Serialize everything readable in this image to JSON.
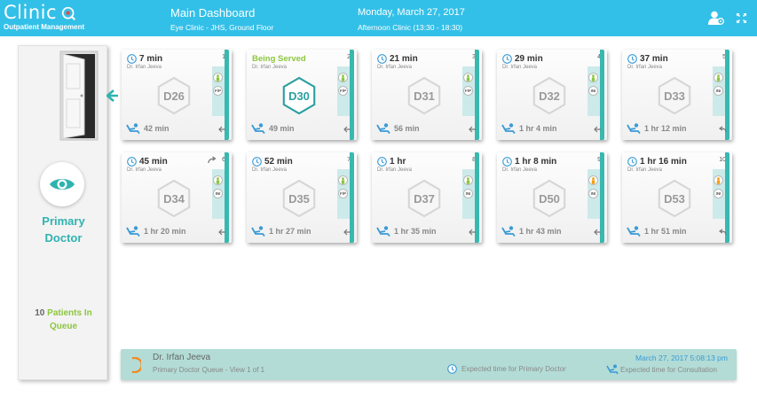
{
  "header": {
    "brand": "Clinic",
    "brand_sub": "Outpatient Management",
    "title": "Main Dashboard",
    "subtitle": "Eye Clinic - JHS, Ground Floor",
    "date": "Monday, March 27, 2017",
    "session": "Afternoon Clinic (13:30 - 18:30)",
    "icons": [
      "user-settings-icon",
      "fullscreen-icon"
    ]
  },
  "panel": {
    "role_line1": "Primary",
    "role_line2": "Doctor",
    "queue_count": "10",
    "queue_label1": "Patients In",
    "queue_label2": "Queue"
  },
  "cards": [
    {
      "time": "7 min",
      "doctor": "Dr. Irfan Jeeva",
      "num": "1",
      "code": "D26",
      "wait": "42 min",
      "served": false,
      "status": "F/P",
      "status_color": "#8cc63f",
      "ret": false,
      "fwd": false
    },
    {
      "time": "Being Served",
      "doctor": "Dr. Irfan Jeeva",
      "num": "2",
      "code": "D30",
      "wait": "49 min",
      "served": true,
      "status": "F/P",
      "status_color": "#8cc63f",
      "ret": false,
      "fwd": false
    },
    {
      "time": "21 min",
      "doctor": "Dr. Irfan Jeeva",
      "num": "3",
      "code": "D31",
      "wait": "56 min",
      "served": false,
      "status": "F/P",
      "status_color": "#8cc63f",
      "ret": false,
      "fwd": false
    },
    {
      "time": "29 min",
      "doctor": "Dr. Irfan Jeeva",
      "num": "4",
      "code": "D32",
      "wait": "1 hr 4 min",
      "served": false,
      "status": "INI",
      "status_color": "#8cc63f",
      "ret": false,
      "fwd": false
    },
    {
      "time": "37 min",
      "doctor": "Dr. Irfan Jeeva",
      "num": "5",
      "code": "D33",
      "wait": "1 hr 12 min",
      "served": false,
      "status": "INI",
      "status_color": "#8cc63f",
      "ret": true,
      "fwd": false
    },
    {
      "time": "45 min",
      "doctor": "Dr. Irfan Jeeva",
      "num": "6",
      "code": "D34",
      "wait": "1 hr 20 min",
      "served": false,
      "status": "INI",
      "status_color": "#8cc63f",
      "ret": false,
      "fwd": true
    },
    {
      "time": "52 min",
      "doctor": "Dr. Irfan Jeeva",
      "num": "7",
      "code": "D35",
      "wait": "1 hr 27 min",
      "served": false,
      "status": "F/P",
      "status_color": "#8cc63f",
      "ret": false,
      "fwd": false
    },
    {
      "time": "1 hr",
      "doctor": "Dr. Irfan Jeeva",
      "num": "8",
      "code": "D37",
      "wait": "1 hr 35 min",
      "served": false,
      "status": "INI",
      "status_color": "#8cc63f",
      "ret": false,
      "fwd": false
    },
    {
      "time": "1 hr 8 min",
      "doctor": "Dr. Irfan Jeeva",
      "num": "9",
      "code": "D50",
      "wait": "1 hr 43 min",
      "served": false,
      "status": "INI",
      "status_color": "#f39c12",
      "ret": false,
      "fwd": false
    },
    {
      "time": "1 hr 16 min",
      "doctor": "Dr. Irfan Jeeva",
      "num": "10",
      "code": "D53",
      "wait": "1 hr 51 min",
      "served": false,
      "status": "INI",
      "status_color": "#f39c12",
      "ret": true,
      "fwd": false
    }
  ],
  "footer": {
    "doctor": "Dr. Irfan Jeeva",
    "queue_view": "Primary Doctor Queue - View 1 of 1",
    "legend_primary": "Expected time for Primary Doctor",
    "timestamp": "March 27, 2017 5:08:13 pm",
    "legend_consult": "Expected time for Consultation"
  },
  "colors": {
    "header": "#33c0e8",
    "accent_teal": "#39b8b0",
    "served_green": "#8cc63f",
    "footer_bg": "#b3dcd6"
  }
}
